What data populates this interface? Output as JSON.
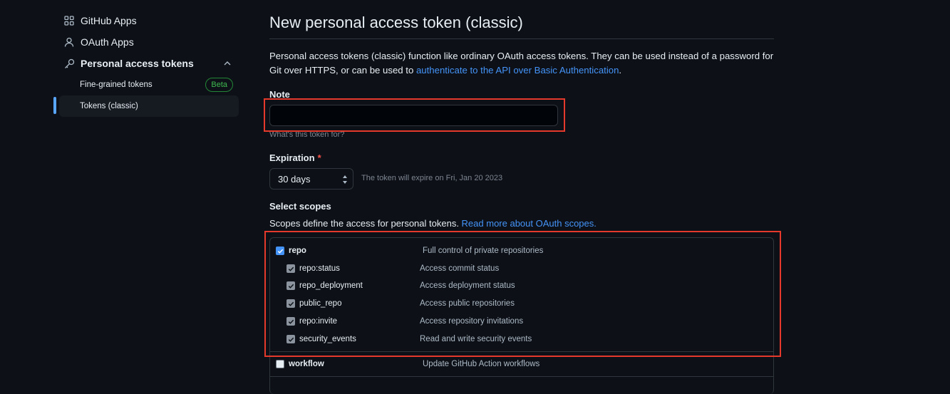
{
  "sidebar": {
    "items": [
      {
        "label": "GitHub Apps",
        "icon": "apps-grid-icon"
      },
      {
        "label": "OAuth Apps",
        "icon": "person-icon"
      },
      {
        "label": "Personal access tokens",
        "icon": "key-icon"
      }
    ],
    "sub_items": [
      {
        "label": "Fine-grained tokens",
        "badge": "Beta"
      },
      {
        "label": "Tokens (classic)",
        "active": true
      }
    ]
  },
  "main": {
    "title": "New personal access token (classic)",
    "description_prefix": "Personal access tokens (classic) function like ordinary OAuth access tokens. They can be used instead of a password for Git over HTTPS, or can be used to ",
    "description_link": "authenticate to the API over Basic Authentication",
    "description_suffix": ".",
    "note": {
      "label": "Note",
      "value": "",
      "hint": "What's this token for?"
    },
    "expiration": {
      "label": "Expiration",
      "required_mark": "*",
      "selected": "30 days",
      "note": "The token will expire on Fri, Jan 20 2023"
    },
    "scopes": {
      "label": "Select scopes",
      "description": "Scopes define the access for personal tokens. ",
      "link": "Read more about OAuth scopes.",
      "rows": [
        {
          "name": "repo",
          "desc": "Full control of private repositories",
          "checked": true,
          "parent": true
        },
        {
          "name": "repo:status",
          "desc": "Access commit status",
          "checked": true,
          "parent": false
        },
        {
          "name": "repo_deployment",
          "desc": "Access deployment status",
          "checked": true,
          "parent": false
        },
        {
          "name": "public_repo",
          "desc": "Access public repositories",
          "checked": true,
          "parent": false
        },
        {
          "name": "repo:invite",
          "desc": "Access repository invitations",
          "checked": true,
          "parent": false
        },
        {
          "name": "security_events",
          "desc": "Read and write security events",
          "checked": true,
          "parent": false
        },
        {
          "name": "workflow",
          "desc": "Update GitHub Action workflows",
          "checked": false,
          "parent": true
        }
      ]
    }
  },
  "colors": {
    "background": "#0d1117",
    "accent": "#4493f8",
    "highlight": "#e5392c",
    "success": "#3fb950",
    "danger": "#f85149"
  }
}
